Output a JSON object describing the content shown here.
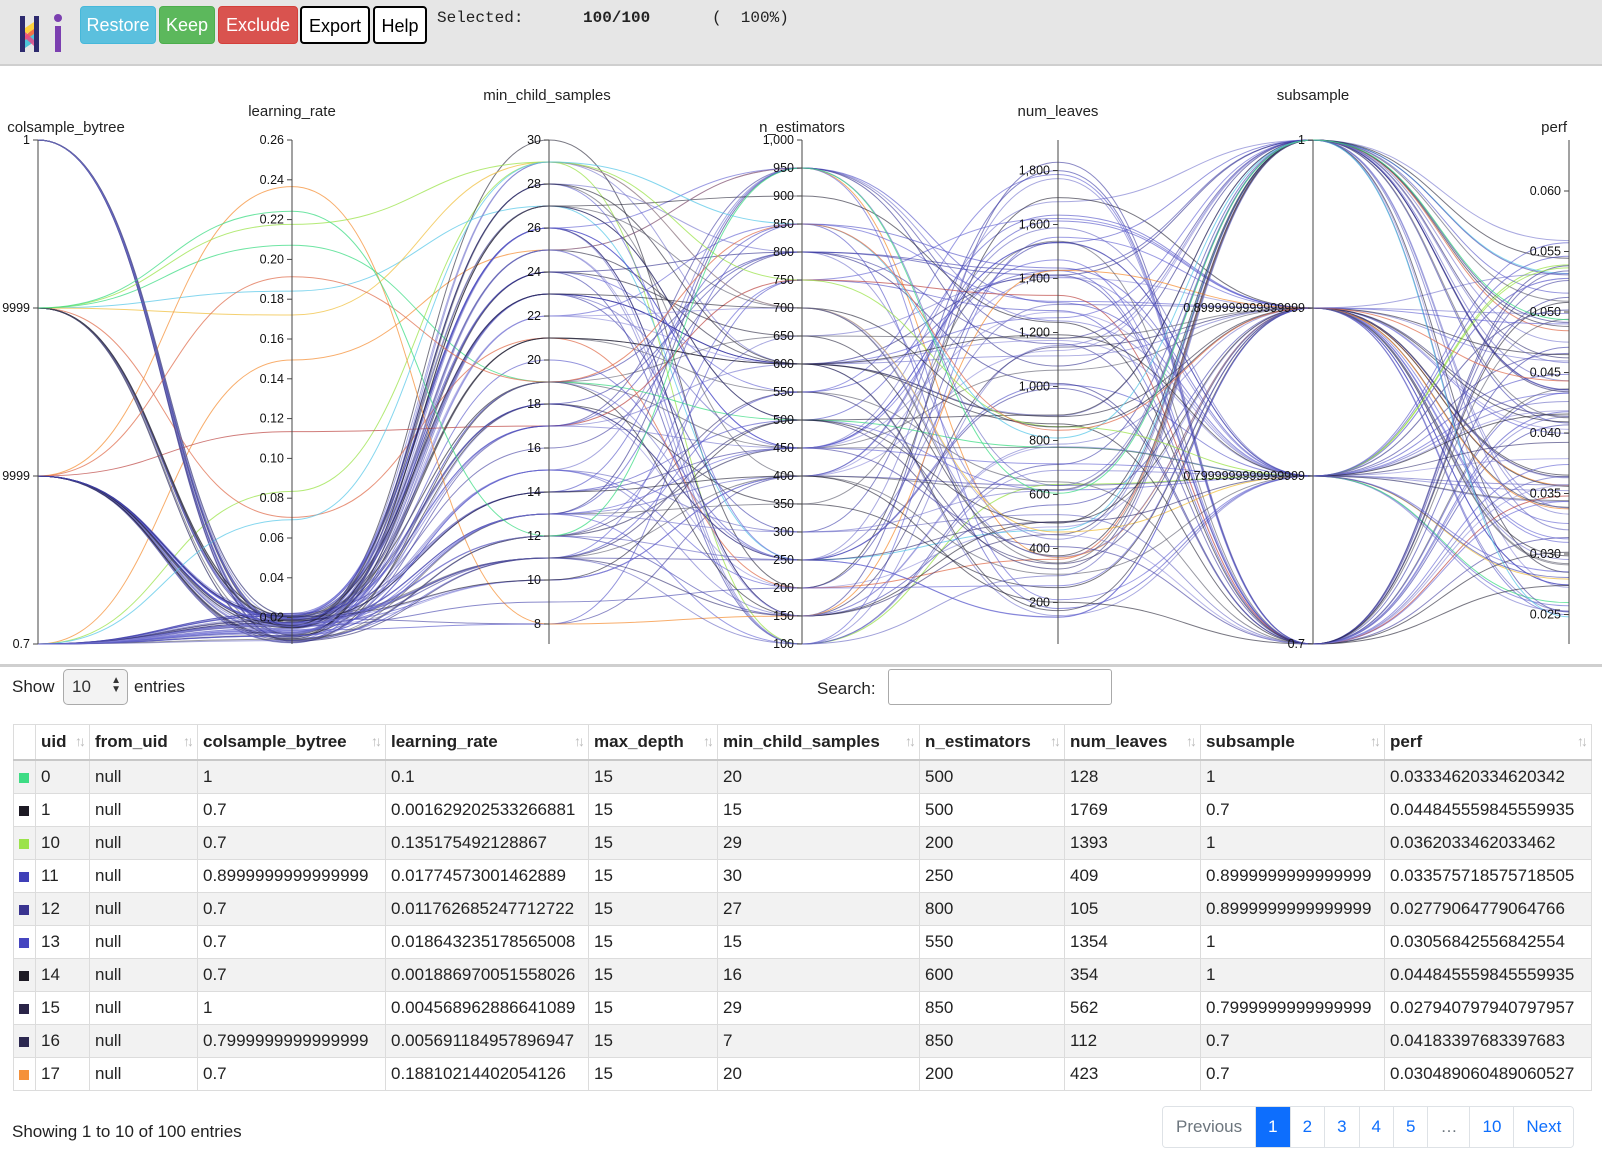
{
  "header": {
    "buttons": {
      "restore": "Restore",
      "keep": "Keep",
      "exclude": "Exclude",
      "export": "Export",
      "help": "Help"
    },
    "selected_label": "Selected:",
    "selected_count": "100/100",
    "selected_pct": "(  100%)"
  },
  "parallel_plot": {
    "axes": [
      {
        "name": "colsample_bytree",
        "ticks": [
          "1",
          "9999",
          "9999",
          "0.7"
        ]
      },
      {
        "name": "learning_rate",
        "ticks": [
          "0.26",
          "0.24",
          "0.22",
          "0.20",
          "0.18",
          "0.16",
          "0.14",
          "0.12",
          "0.10",
          "0.08",
          "0.06",
          "0.04",
          "0.02"
        ]
      },
      {
        "name": "min_child_samples",
        "ticks": [
          "30",
          "28",
          "26",
          "24",
          "22",
          "20",
          "18",
          "16",
          "14",
          "12",
          "10",
          "8"
        ]
      },
      {
        "name": "n_estimators",
        "ticks": [
          "1,000",
          "950",
          "900",
          "850",
          "800",
          "750",
          "700",
          "650",
          "600",
          "550",
          "500",
          "450",
          "400",
          "350",
          "300",
          "250",
          "200",
          "150",
          "100"
        ]
      },
      {
        "name": "num_leaves",
        "ticks": [
          "1,800",
          "1,600",
          "1,400",
          "1,200",
          "1,000",
          "800",
          "600",
          "400",
          "200"
        ]
      },
      {
        "name": "subsample",
        "ticks": [
          "1",
          "0.8999999999999999",
          "0.7999999999999999",
          "0.7"
        ]
      },
      {
        "name": "perf",
        "ticks": [
          "0.060",
          "0.055",
          "0.050",
          "0.045",
          "0.040",
          "0.035",
          "0.030",
          "0.025"
        ]
      }
    ]
  },
  "table_controls": {
    "show_label": "Show",
    "page_length": "10",
    "entries_label": "entries",
    "search_label": "Search:",
    "search_value": ""
  },
  "table": {
    "columns": [
      "uid",
      "from_uid",
      "colsample_bytree",
      "learning_rate",
      "max_depth",
      "min_child_samples",
      "n_estimators",
      "num_leaves",
      "subsample",
      "perf"
    ],
    "rows": [
      {
        "color": "#3ddc84",
        "cells": [
          "0",
          "null",
          "1",
          "0.1",
          "15",
          "20",
          "500",
          "128",
          "1",
          "0.03334620334620342"
        ]
      },
      {
        "color": "#1d1a24",
        "cells": [
          "1",
          "null",
          "0.7",
          "0.001629202533266881",
          "15",
          "15",
          "500",
          "1769",
          "0.7",
          "0.044845559845559935"
        ]
      },
      {
        "color": "#9be34a",
        "cells": [
          "10",
          "null",
          "0.7",
          "0.135175492128867",
          "15",
          "29",
          "200",
          "1393",
          "1",
          "0.0362033462033462"
        ]
      },
      {
        "color": "#4040b8",
        "cells": [
          "11",
          "null",
          "0.8999999999999999",
          "0.01774573001462889",
          "15",
          "30",
          "250",
          "409",
          "0.8999999999999999",
          "0.033575718575718505"
        ]
      },
      {
        "color": "#3a3490",
        "cells": [
          "12",
          "null",
          "0.7",
          "0.011762685247712722",
          "15",
          "27",
          "800",
          "105",
          "0.8999999999999999",
          "0.02779064779064766"
        ]
      },
      {
        "color": "#4545c0",
        "cells": [
          "13",
          "null",
          "0.7",
          "0.018643235178565008",
          "15",
          "15",
          "550",
          "1354",
          "1",
          "0.03056842556842554"
        ]
      },
      {
        "color": "#1d1a24",
        "cells": [
          "14",
          "null",
          "0.7",
          "0.001886970051558026",
          "15",
          "16",
          "600",
          "354",
          "1",
          "0.044845559845559935"
        ]
      },
      {
        "color": "#2a2448",
        "cells": [
          "15",
          "null",
          "1",
          "0.004568962886641089",
          "15",
          "29",
          "850",
          "562",
          "0.7999999999999999",
          "0.027940797940797957"
        ]
      },
      {
        "color": "#2c2850",
        "cells": [
          "16",
          "null",
          "0.7999999999999999",
          "0.005691184957896947",
          "15",
          "7",
          "850",
          "112",
          "0.7",
          "0.04183397683397683"
        ]
      },
      {
        "color": "#f5913a",
        "cells": [
          "17",
          "null",
          "0.7",
          "0.18810214402054126",
          "15",
          "20",
          "200",
          "423",
          "0.7",
          "0.030489060489060527"
        ]
      }
    ]
  },
  "footer": {
    "info": "Showing 1 to 10 of 100 entries",
    "pagination": [
      "Previous",
      "1",
      "2",
      "3",
      "4",
      "5",
      "…",
      "10",
      "Next"
    ]
  }
}
